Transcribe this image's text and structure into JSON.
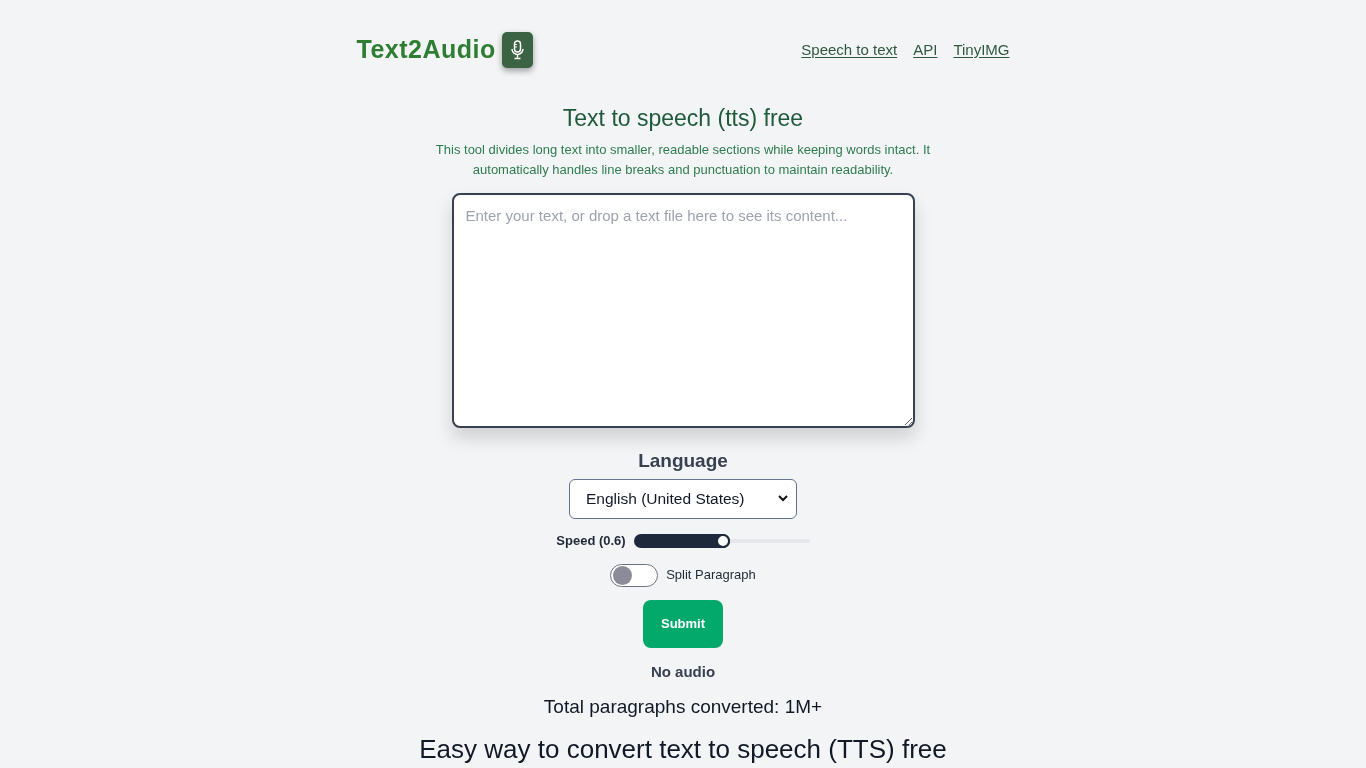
{
  "header": {
    "logo": "Text2Audio",
    "nav_links": [
      "Speech to text",
      "API",
      "TinyIMG"
    ]
  },
  "main": {
    "title": "Text to speech (tts) free",
    "description": "This tool divides long text into smaller, readable sections while keeping words intact. It automatically handles line breaks and punctuation to maintain readability.",
    "text_input": {
      "placeholder": "Enter your text, or drop a text file here to see its content..."
    },
    "language": {
      "label": "Language",
      "value": "English (United States)"
    },
    "speed": {
      "label": "Speed (0.6)",
      "level": 0.55
    },
    "split_paragraph": {
      "label": "Split Paragraph",
      "on": false
    },
    "submit": "Submit",
    "audio_status": "No audio",
    "stats": "Total paragraphs converted: 1M+"
  },
  "section": {
    "heading": "Easy way to convert text to speech (TTS) free"
  }
}
